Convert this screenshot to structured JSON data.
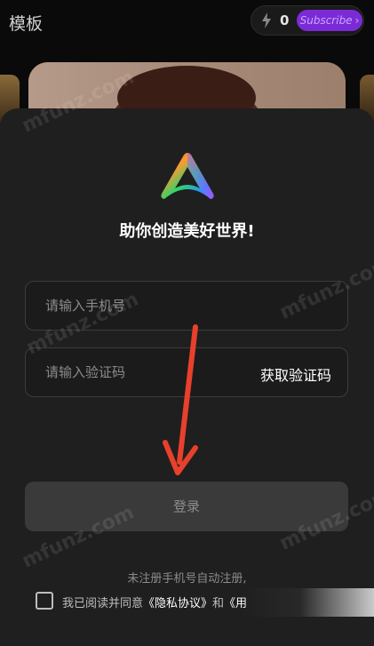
{
  "header": {
    "title": "模板",
    "credits": "0",
    "subscribe_label": "Subscribe"
  },
  "login": {
    "slogan": "助你创造美好世界!",
    "phone_placeholder": "请输入手机号",
    "code_placeholder": "请输入验证码",
    "get_code_label": "获取验证码",
    "login_label": "登录",
    "notice": "未注册手机号自动注册,",
    "agree_prefix": "我已阅读并同意",
    "privacy_link": "《隐私协议》",
    "agree_and": "和",
    "user_link": "《用"
  },
  "watermark": "mfunz.com",
  "colors": {
    "background": "#0a0a0a",
    "sheet": "#1f1f1f",
    "subscribe": "#7b2bd6",
    "annotation_arrow": "#e8402c"
  }
}
